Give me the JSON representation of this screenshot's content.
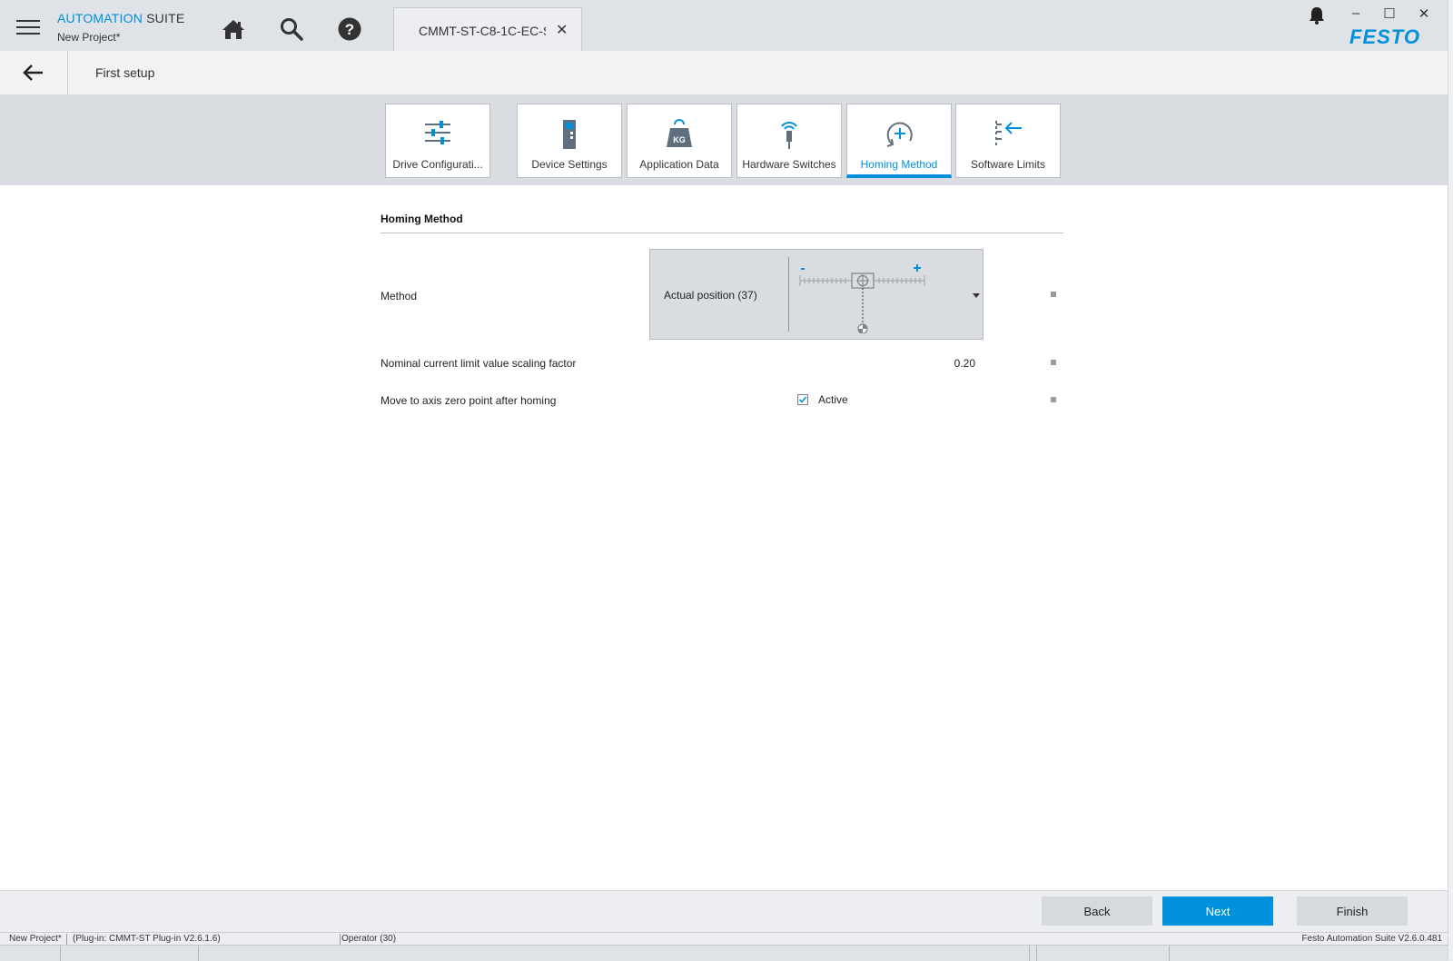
{
  "titlebar": {
    "brand_part1": "AUTOMATION",
    "brand_part2": " SUITE",
    "project": "New Project*",
    "doc_tab_label": "CMMT-ST-C8-1C-EC-S",
    "doc_tab_close": "✕",
    "minimize": "–",
    "maximize": "☐",
    "close": "✕",
    "logo": "FESTO"
  },
  "breadcrumb": {
    "title": "First setup"
  },
  "steps": [
    {
      "label": "Drive Configurati...",
      "icon": "sliders-icon"
    },
    {
      "label": "Device Settings",
      "icon": "device-icon"
    },
    {
      "label": "Application Data",
      "icon": "weight-kg-icon"
    },
    {
      "label": "Hardware Switches",
      "icon": "sensor-switch-icon"
    },
    {
      "label": "Homing Method",
      "icon": "homing-icon",
      "active": true
    },
    {
      "label": "Software Limits",
      "icon": "software-limits-icon"
    }
  ],
  "section": {
    "title": "Homing Method",
    "method_label": "Method",
    "method_value": "Actual position (37)",
    "scaling_label": "Nominal current limit value scaling factor",
    "scaling_value": "0.20",
    "zero_label": "Move to axis zero point after homing",
    "zero_checkbox_label": "Active",
    "zero_checked": true
  },
  "footer": {
    "back": "Back",
    "next": "Next",
    "finish": "Finish"
  },
  "status": {
    "project": "New Project*",
    "plugin": "(Plug-in: CMMT-ST Plug-in V2.6.1.6)",
    "operator": "Operator (30)",
    "version": "Festo Automation Suite V2.6.0.481"
  },
  "colors": {
    "accent": "#0091dc",
    "titlebar_bg": "#dfe2e6",
    "stepbar_bg": "#d9dce0"
  }
}
